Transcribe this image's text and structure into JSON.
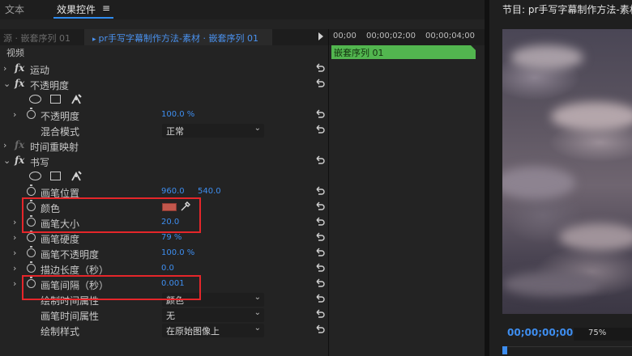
{
  "tabs": {
    "text": "文本",
    "effect_controls": "效果控件",
    "menu_icon": "≡"
  },
  "header": {
    "source_tab": "源 · 嵌套序列 01",
    "sequence_tab": "pr手写字幕制作方法-素材 · 嵌套序列 01",
    "ruler_labels": [
      "00;00",
      "00;00;02;00",
      "00;00;04;00"
    ]
  },
  "timeline": {
    "clip_label": "嵌套序列 01"
  },
  "section": {
    "video": "视频"
  },
  "effects": {
    "motion": "运动",
    "opacity": "不透明度",
    "opacity_value_label": "不透明度",
    "opacity_value": "100.0 %",
    "blend_mode_label": "混合模式",
    "blend_mode_value": "正常",
    "time_remap": "时间重映射",
    "write": "书写",
    "brush_position_label": "画笔位置",
    "brush_position_x": "960.0",
    "brush_position_y": "540.0",
    "color_label": "颜色",
    "color_value": "#c2574c",
    "brush_size_label": "画笔大小",
    "brush_size_value": "20.0",
    "brush_hardness_label": "画笔硬度",
    "brush_hardness_value": "79 %",
    "brush_opacity_label": "画笔不透明度",
    "brush_opacity_value": "100.0 %",
    "stroke_length_label": "描边长度（秒）",
    "stroke_length_value": "0.0",
    "brush_spacing_label": "画笔间隔（秒）",
    "brush_spacing_value": "0.001",
    "paint_time_label": "绘制时间属性",
    "paint_time_value": "颜色",
    "brush_time_label": "画笔时间属性",
    "brush_time_value": "无",
    "paint_style_label": "绘制样式",
    "paint_style_value": "在原始图像上"
  },
  "program": {
    "title": "节目: pr手写字幕制作方法-素材",
    "timecode": "00;00;00;00",
    "zoom": "75%"
  },
  "colors": {
    "accent_blue": "#3e8ef0",
    "clip_green": "#52b64f",
    "highlight_red": "#e5262a"
  }
}
